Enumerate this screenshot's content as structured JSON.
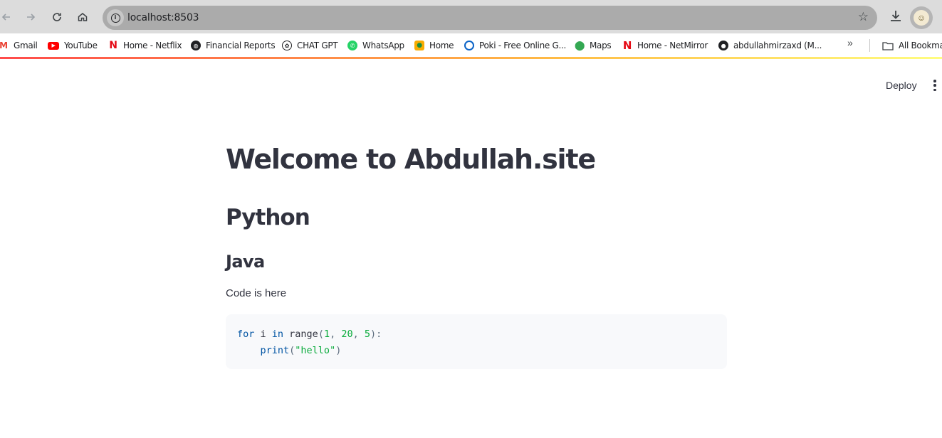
{
  "browser": {
    "url": "localhost:8503",
    "bookmarks": [
      {
        "label": "Gmail",
        "icon": "gmail-icon",
        "color": "#ea4335"
      },
      {
        "label": "YouTube",
        "icon": "youtube-icon",
        "color": "#ff0000"
      },
      {
        "label": "Home - Netflix",
        "icon": "netflix-icon",
        "color": "#e50914"
      },
      {
        "label": "Financial Reports",
        "icon": "globe-icon",
        "color": "#202124"
      },
      {
        "label": "CHAT GPT",
        "icon": "chatgpt-icon",
        "color": "#202124"
      },
      {
        "label": "WhatsApp",
        "icon": "whatsapp-icon",
        "color": "#25d366"
      },
      {
        "label": "Home",
        "icon": "classroom-icon",
        "color": "#f9ab00"
      },
      {
        "label": "Poki - Free Online G...",
        "icon": "poki-icon",
        "color": "#0b63c7"
      },
      {
        "label": "Maps",
        "icon": "maps-icon",
        "color": "#34a853"
      },
      {
        "label": "Home - NetMirror",
        "icon": "netmirror-icon",
        "color": "#e50914"
      },
      {
        "label": "abdullahmirzaxd (M...",
        "icon": "github-icon",
        "color": "#202124"
      },
      {
        "label": "All Bookmarks",
        "icon": "folder-icon",
        "color": "#3c4043"
      }
    ]
  },
  "app": {
    "deploy_label": "Deploy",
    "title": "Welcome to Abdullah.site",
    "header": "Python",
    "subheader": "Java",
    "text": "Code is here",
    "code": {
      "line1": {
        "kw_for": "for",
        "var": " i ",
        "kw_in": "in",
        "fn": " range",
        "open": "(",
        "a": "1",
        "c1": ", ",
        "b": "20",
        "c2": ", ",
        "c": "5",
        "close": "):"
      },
      "line2": {
        "indent": "    ",
        "fn": "print",
        "open": "(",
        "str": "\"hello\"",
        "close": ")"
      }
    }
  },
  "colors": {
    "streamlit_accent": "#ff4b4b",
    "text": "#31333f",
    "code_bg": "#f8f9fb"
  }
}
